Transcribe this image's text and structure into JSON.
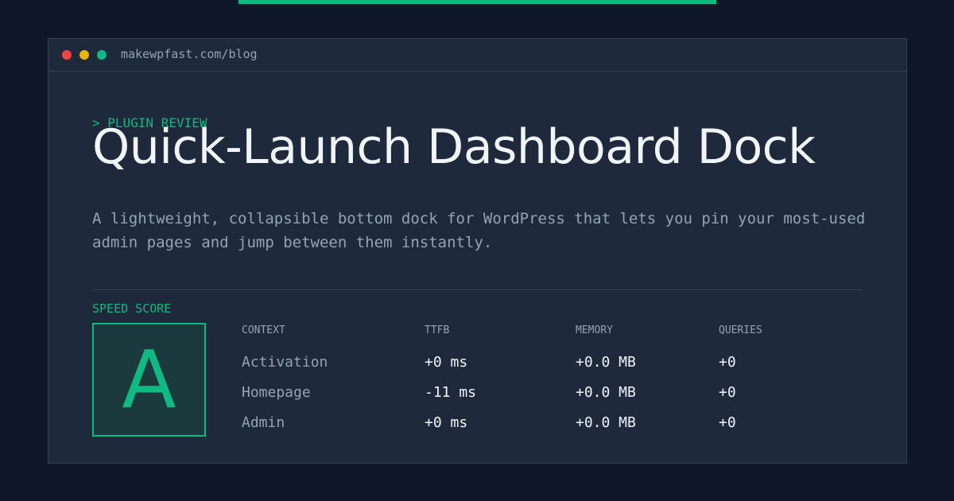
{
  "window": {
    "url": "makewpfast.com/blog",
    "controls": [
      {
        "name": "close",
        "color": "#ef4444"
      },
      {
        "name": "minimize",
        "color": "#eab308"
      },
      {
        "name": "maximize",
        "color": "#10b981"
      }
    ]
  },
  "article": {
    "eyebrow": "> PLUGIN REVIEW",
    "title": "Quick-Launch Dashboard Dock",
    "description": "A lightweight, collapsible bottom dock for WordPress that lets you pin your most-used admin pages and jump between them instantly."
  },
  "score": {
    "label": "SPEED SCORE",
    "grade": "A"
  },
  "table": {
    "headers": [
      "CONTEXT",
      "TTFB",
      "MEMORY",
      "QUERIES"
    ],
    "rows": [
      [
        "Activation",
        "+0 ms",
        "+0.0 MB",
        "+0"
      ],
      [
        "Homepage",
        "-11 ms",
        "+0.0 MB",
        "+0"
      ],
      [
        "Admin",
        "+0 ms",
        "+0.0 MB",
        "+0"
      ]
    ]
  },
  "colors": {
    "accent": "#10b981",
    "background": "#0f172a",
    "panel": "#1e293b"
  }
}
